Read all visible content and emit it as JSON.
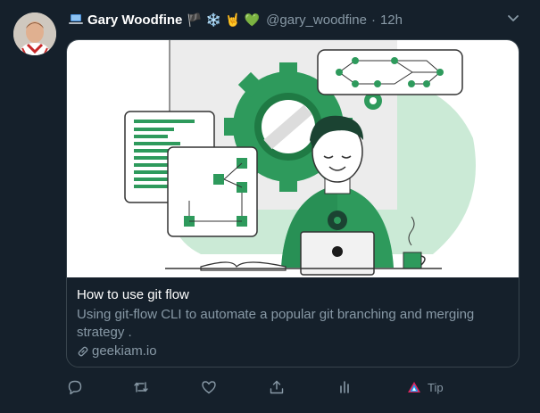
{
  "tweet": {
    "author_name": "Gary Woodfine",
    "name_emojis": [
      "🏴",
      "❄️",
      "🤘",
      "💚"
    ],
    "handle": "@gary_woodfine",
    "separator": "·",
    "time": "12h"
  },
  "card": {
    "title": "How to use git flow",
    "description": "Using git-flow CLI to automate a popular git branching and merging strategy .",
    "domain": "geekiam.io"
  },
  "actions": {
    "tip_label": "Tip"
  },
  "colors": {
    "background": "#15202b",
    "border": "#38444d",
    "muted_text": "#8899a6",
    "illustration_green": "#2e9a5c",
    "illustration_light_green": "#cbead6"
  }
}
